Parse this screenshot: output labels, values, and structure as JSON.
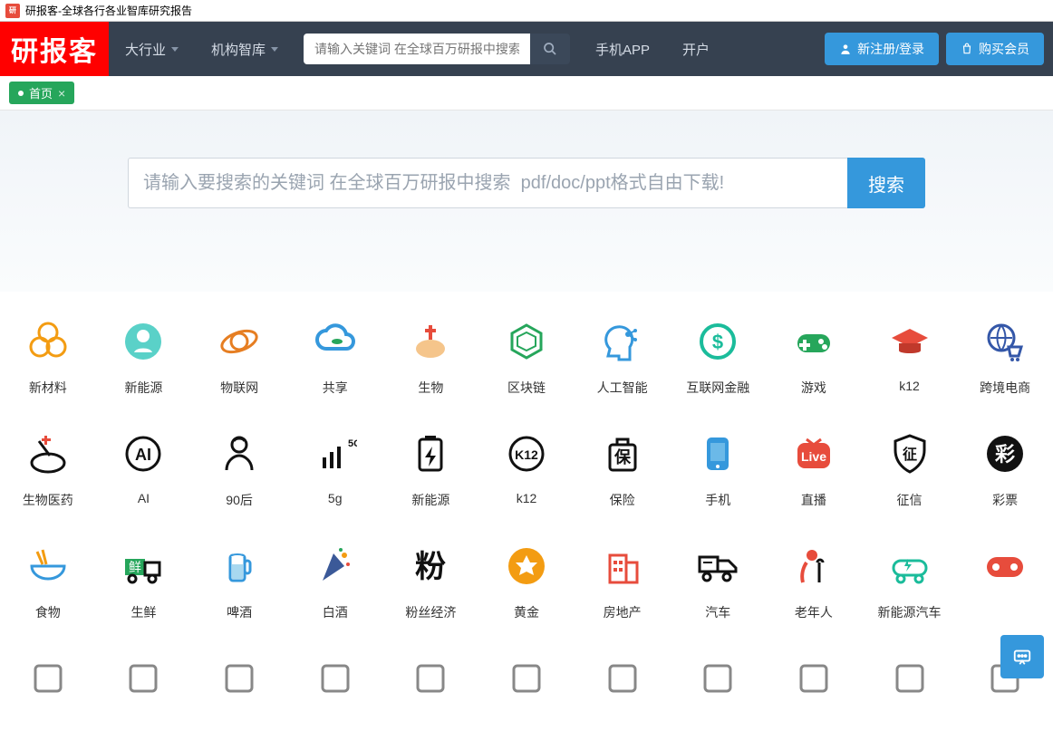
{
  "browser": {
    "title": "研报客-全球各行各业智库研究报告"
  },
  "navbar": {
    "logo": "研报客",
    "industry": "大行业",
    "thinktank": "机构智库",
    "search_placeholder": "请输入关键词 在全球百万研报中搜索",
    "app": "手机APP",
    "open_account": "开户",
    "register": "新注册/登录",
    "buy": "购买会员"
  },
  "tabs": {
    "home": "首页"
  },
  "hero": {
    "placeholder": "请输入要搜索的关键词 在全球百万研报中搜索  pdf/doc/ppt格式自由下载!",
    "button": "搜索"
  },
  "categories": [
    {
      "id": "new-materials",
      "label": "新材料",
      "icon": "materials"
    },
    {
      "id": "new-energy",
      "label": "新能源",
      "icon": "globe-person"
    },
    {
      "id": "iot",
      "label": "物联网",
      "icon": "orbit"
    },
    {
      "id": "sharing",
      "label": "共享",
      "icon": "cloud"
    },
    {
      "id": "biology",
      "label": "生物",
      "icon": "biology"
    },
    {
      "id": "blockchain",
      "label": "区块链",
      "icon": "blockchain"
    },
    {
      "id": "ai-intel",
      "label": "人工智能",
      "icon": "ai-head"
    },
    {
      "id": "internet-fin",
      "label": "互联网金融",
      "icon": "dollar-circle"
    },
    {
      "id": "games",
      "label": "游戏",
      "icon": "gamepad-green"
    },
    {
      "id": "k12a",
      "label": "k12",
      "icon": "grad-cap"
    },
    {
      "id": "cross-border",
      "label": "跨境电商",
      "icon": "globe-cart"
    },
    {
      "id": "biopharma",
      "label": "生物医药",
      "icon": "biopharma"
    },
    {
      "id": "ai",
      "label": "AI",
      "icon": "ai-circle"
    },
    {
      "id": "post90",
      "label": "90后",
      "icon": "person"
    },
    {
      "id": "5g",
      "label": "5g",
      "icon": "5g"
    },
    {
      "id": "new-energy2",
      "label": "新能源",
      "icon": "charge"
    },
    {
      "id": "k12b",
      "label": "k12",
      "icon": "k12-circle"
    },
    {
      "id": "insurance",
      "label": "保险",
      "icon": "insurance"
    },
    {
      "id": "mobile",
      "label": "手机",
      "icon": "phone"
    },
    {
      "id": "live",
      "label": "直播",
      "icon": "live"
    },
    {
      "id": "credit",
      "label": "征信",
      "icon": "credit-shield"
    },
    {
      "id": "lottery",
      "label": "彩票",
      "icon": "lottery"
    },
    {
      "id": "food",
      "label": "食物",
      "icon": "bowl"
    },
    {
      "id": "fresh",
      "label": "生鲜",
      "icon": "fresh-truck"
    },
    {
      "id": "beer",
      "label": "啤酒",
      "icon": "beer"
    },
    {
      "id": "baijiu",
      "label": "白酒",
      "icon": "party"
    },
    {
      "id": "fans-economy",
      "label": "粉丝经济",
      "icon": "fen"
    },
    {
      "id": "gold",
      "label": "黄金",
      "icon": "gold"
    },
    {
      "id": "real-estate",
      "label": "房地产",
      "icon": "building"
    },
    {
      "id": "auto",
      "label": "汽车",
      "icon": "truck"
    },
    {
      "id": "elderly",
      "label": "老年人",
      "icon": "elder"
    },
    {
      "id": "nev",
      "label": "新能源汽车",
      "icon": "ev-car"
    },
    {
      "id": "games-red",
      "label": "",
      "icon": "gamepad-red"
    },
    {
      "id": "r4c1",
      "label": "",
      "icon": "p1"
    },
    {
      "id": "r4c2",
      "label": "",
      "icon": "p2"
    },
    {
      "id": "r4c3",
      "label": "",
      "icon": "p3"
    },
    {
      "id": "r4c4",
      "label": "",
      "icon": "p4"
    },
    {
      "id": "r4c5",
      "label": "",
      "icon": "p5"
    },
    {
      "id": "r4c6",
      "label": "",
      "icon": "p6"
    },
    {
      "id": "r4c7",
      "label": "",
      "icon": "p7"
    },
    {
      "id": "r4c8",
      "label": "",
      "icon": "p8"
    },
    {
      "id": "r4c9",
      "label": "",
      "icon": "p9"
    },
    {
      "id": "r4c10",
      "label": "",
      "icon": "p10"
    },
    {
      "id": "r4c11",
      "label": "",
      "icon": "p11"
    }
  ]
}
